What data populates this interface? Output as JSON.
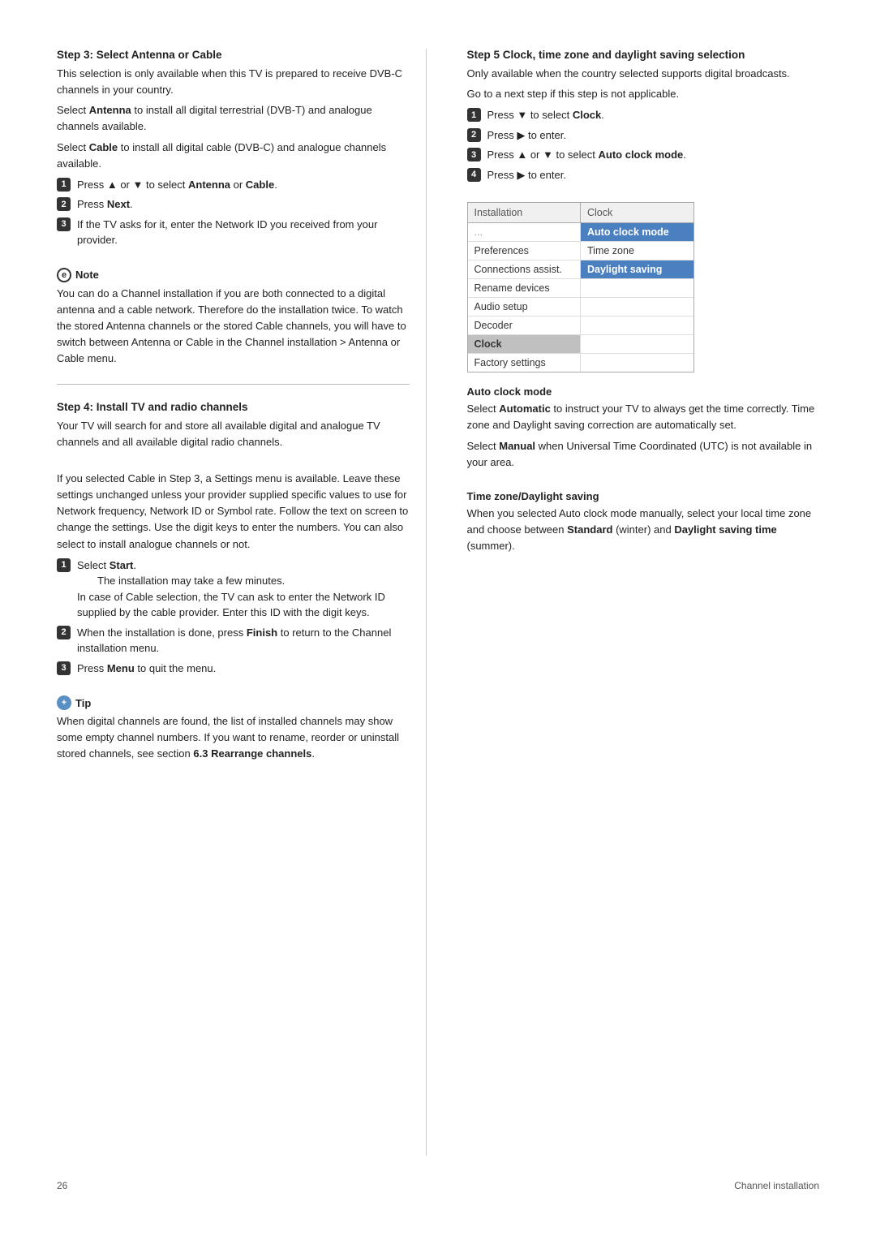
{
  "page": {
    "number": "26",
    "label": "Channel installation"
  },
  "left_column": {
    "step3": {
      "title": "Step 3:  Select Antenna or Cable",
      "intro": "This selection is only available when this TV is prepared to receive DVB-C channels in your country.",
      "para1": "Select Antenna to install all digital terrestrial (DVB-T) and analogue channels available.",
      "para2": "Select Cable to install all digital cable (DVB-C) and analogue channels available.",
      "steps": [
        {
          "num": "1",
          "text_prefix": "Press ▲ or ▼ to select ",
          "bold": "Antenna",
          "text_mid": " or ",
          "bold2": "Cable",
          "text_suffix": "."
        },
        {
          "num": "2",
          "text_prefix": "Press ",
          "bold": "Next",
          "text_suffix": "."
        },
        {
          "num": "3",
          "text_prefix": "If the TV asks for it, enter the Network ID you received from your provider."
        }
      ]
    },
    "note": {
      "title": "Note",
      "body": "You can do a Channel installation if you are both connected to a digital antenna and a cable network. Therefore do the installation twice. To watch the stored Antenna channels or the stored Cable channels, you will have to switch between Antenna or Cable in the Channel installation > Antenna or Cable menu."
    },
    "step4": {
      "title": "Step 4: Install TV and radio channels",
      "intro": "Your TV will search for and store all available digital and analogue TV channels and all available digital radio channels.",
      "para2": "If you selected Cable in Step 3, a Settings menu is available. Leave these settings unchanged unless your provider supplied specific values to use for Network frequency, Network ID or Symbol rate. Follow the text on screen to change the settings. Use the digit keys to enter the numbers. You can also select to install analogue channels or not.",
      "steps": [
        {
          "num": "1",
          "text_prefix": "Select ",
          "bold": "Start",
          "text_suffix": ".",
          "sub_lines": [
            "The installation may take a few minutes.",
            "In case of Cable selection, the TV can ask to enter the Network ID supplied by the cable provider. Enter this ID with the digit keys."
          ]
        },
        {
          "num": "2",
          "text_prefix": "When the installation is done, press ",
          "bold": "Finish",
          "text_suffix": " to return to the Channel installation menu."
        },
        {
          "num": "3",
          "text_prefix": "Press ",
          "bold": "Menu",
          "text_suffix": " to quit the menu."
        }
      ]
    },
    "tip": {
      "title": "Tip",
      "body": "When digital channels are found, the list of installed channels may show some empty channel numbers. If you want to rename, reorder or uninstall stored channels, see section ",
      "bold_ref": "6.3 Rearrange channels",
      "body_suffix": "."
    }
  },
  "right_column": {
    "step5": {
      "title": "Step 5  Clock, time zone and daylight saving selection",
      "intro": "Only available when the country selected supports digital broadcasts.",
      "sub": "Go to a next step if this step is not applicable.",
      "steps": [
        {
          "num": "1",
          "text_prefix": "Press ▼ to select ",
          "bold": "Clock",
          "text_suffix": "."
        },
        {
          "num": "2",
          "text_prefix": "Press ▶ to enter."
        },
        {
          "num": "3",
          "text_prefix": "Press ▲ or ▼ to select ",
          "bold": "Auto clock mode",
          "text_suffix": "."
        },
        {
          "num": "4",
          "text_prefix": "Press ▶ to enter."
        }
      ]
    },
    "tv_menu": {
      "header_left": "Installation",
      "header_right": "Clock",
      "rows": [
        {
          "left": "...",
          "right": "Auto clock mode",
          "highlight_right": true
        },
        {
          "left": "Preferences",
          "right": "Time zone",
          "highlight_right": false
        },
        {
          "left": "Connections assist.",
          "right": "Daylight saving",
          "highlight_right": true,
          "highlight_left": false
        },
        {
          "left": "Rename devices",
          "right": "",
          "highlight_right": false
        },
        {
          "left": "Audio setup",
          "right": "",
          "highlight_right": false
        },
        {
          "left": "Decoder",
          "right": "",
          "highlight_right": false
        },
        {
          "left": "Clock",
          "right": "",
          "highlight_left": true,
          "highlight_right": false
        },
        {
          "left": "Factory settings",
          "right": "",
          "highlight_right": false
        }
      ]
    },
    "auto_clock": {
      "heading": "Auto clock mode",
      "body": "Select Automatic to instruct your TV to always get the time correctly. Time zone and Daylight saving correction are automatically set.",
      "body2": "Select Manual when Universal Time Coordinated (UTC) is not available in your area."
    },
    "time_zone": {
      "heading": "Time zone/Daylight saving",
      "body": "When you selected Auto clock mode manually, select your local time zone and choose between Standard (winter) and Daylight saving time (summer)."
    }
  }
}
